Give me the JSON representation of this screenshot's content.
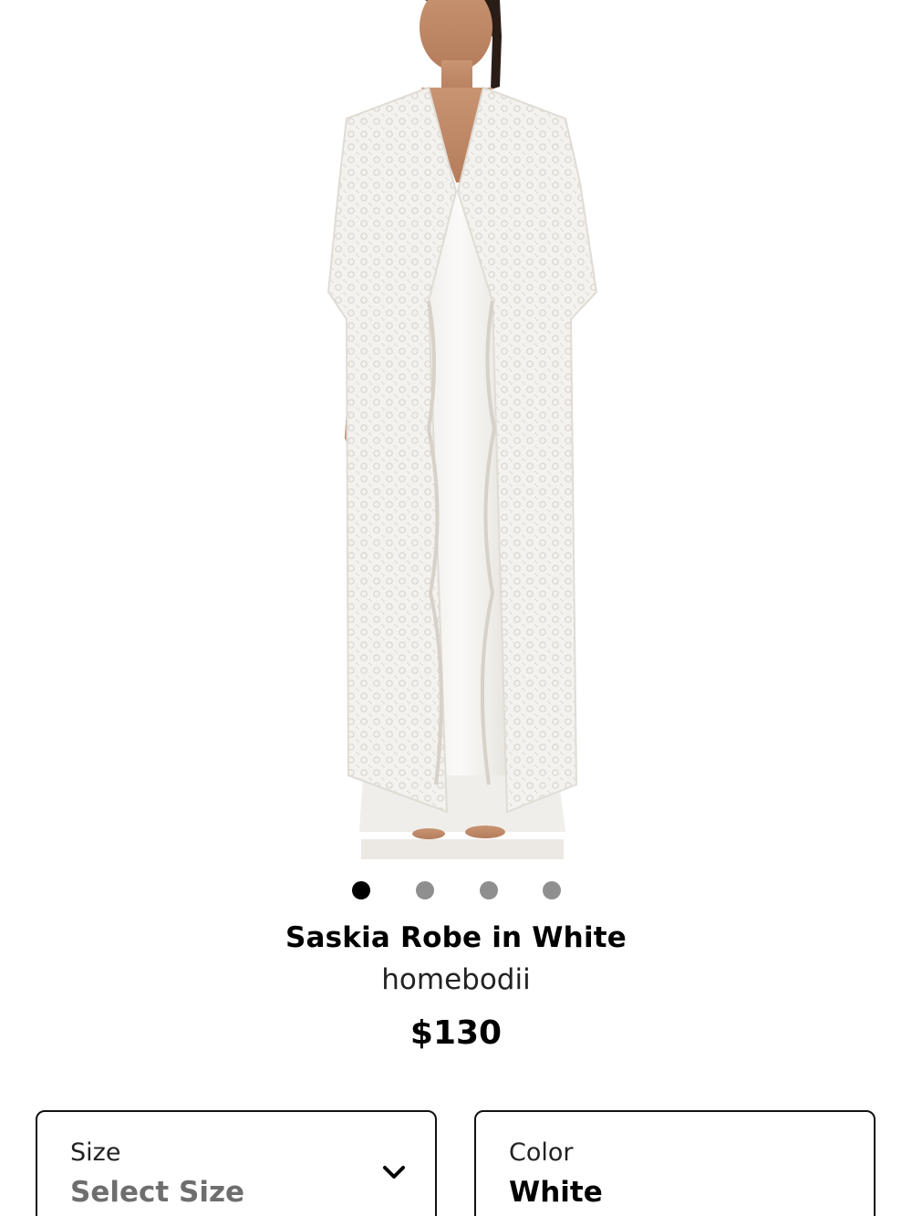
{
  "gallery": {
    "image_alt": "Model wearing white lace robe over white satin slip",
    "dots_count": 4,
    "active_index": 0
  },
  "product": {
    "title": "Saskia Robe in White",
    "brand": "homebodii",
    "price": "$130"
  },
  "size_selector": {
    "label": "Size",
    "value": "Select Size",
    "icon": "chevron-down-icon"
  },
  "color_selector": {
    "label": "Color",
    "value": "White"
  },
  "colors": {
    "active_dot": "#000000",
    "inactive_dot": "#8f8f8f",
    "placeholder_text": "#6e6e6e"
  }
}
